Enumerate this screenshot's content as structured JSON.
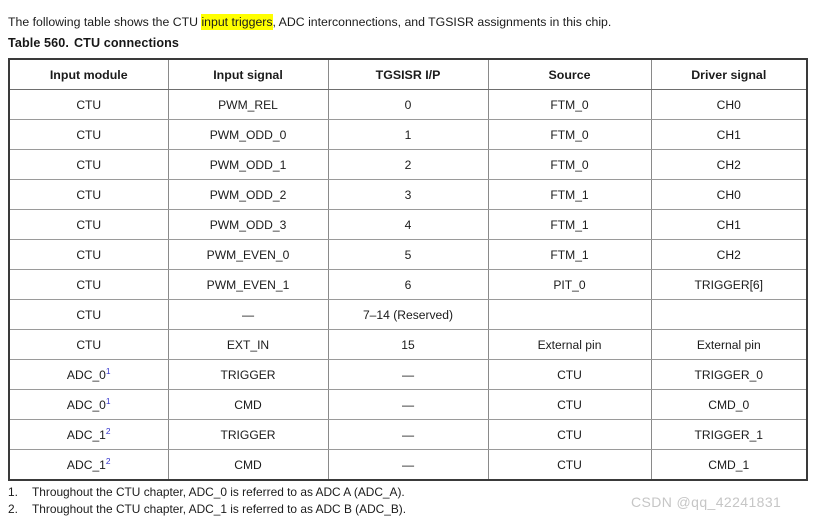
{
  "intro": {
    "before": "The following table shows the CTU ",
    "highlight": "input triggers",
    "after": ", ADC interconnections, and TGSISR assignments in this chip."
  },
  "caption": {
    "number": "Table 560.",
    "title": "CTU connections"
  },
  "table": {
    "headers": [
      "Input module",
      "Input signal",
      "TGSISR I/P",
      "Source",
      "Driver signal"
    ],
    "rows": [
      {
        "module": "CTU",
        "module_sup": "",
        "signal": "PWM_REL",
        "tgsisr": "0",
        "source": "FTM_0",
        "driver": "CH0"
      },
      {
        "module": "CTU",
        "module_sup": "",
        "signal": "PWM_ODD_0",
        "tgsisr": "1",
        "source": "FTM_0",
        "driver": "CH1"
      },
      {
        "module": "CTU",
        "module_sup": "",
        "signal": "PWM_ODD_1",
        "tgsisr": "2",
        "source": "FTM_0",
        "driver": "CH2"
      },
      {
        "module": "CTU",
        "module_sup": "",
        "signal": "PWM_ODD_2",
        "tgsisr": "3",
        "source": "FTM_1",
        "driver": "CH0"
      },
      {
        "module": "CTU",
        "module_sup": "",
        "signal": "PWM_ODD_3",
        "tgsisr": "4",
        "source": "FTM_1",
        "driver": "CH1"
      },
      {
        "module": "CTU",
        "module_sup": "",
        "signal": "PWM_EVEN_0",
        "tgsisr": "5",
        "source": "FTM_1",
        "driver": "CH2"
      },
      {
        "module": "CTU",
        "module_sup": "",
        "signal": "PWM_EVEN_1",
        "tgsisr": "6",
        "source": "PIT_0",
        "driver": "TRIGGER[6]"
      },
      {
        "module": "CTU",
        "module_sup": "",
        "signal": "—",
        "tgsisr": "7–14 (Reserved)",
        "source": "",
        "driver": ""
      },
      {
        "module": "CTU",
        "module_sup": "",
        "signal": "EXT_IN",
        "tgsisr": "15",
        "source": "External pin",
        "driver": "External pin"
      },
      {
        "module": "ADC_0",
        "module_sup": "1",
        "signal": "TRIGGER",
        "tgsisr": "—",
        "source": "CTU",
        "driver": "TRIGGER_0"
      },
      {
        "module": "ADC_0",
        "module_sup": "1",
        "signal": "CMD",
        "tgsisr": "—",
        "source": "CTU",
        "driver": "CMD_0"
      },
      {
        "module": "ADC_1",
        "module_sup": "2",
        "signal": "TRIGGER",
        "tgsisr": "—",
        "source": "CTU",
        "driver": "TRIGGER_1"
      },
      {
        "module": "ADC_1",
        "module_sup": "2",
        "signal": "CMD",
        "tgsisr": "—",
        "source": "CTU",
        "driver": "CMD_1"
      }
    ]
  },
  "footnotes": [
    {
      "number": "1.",
      "text": "Throughout the CTU chapter, ADC_0 is referred to as ADC A (ADC_A)."
    },
    {
      "number": "2.",
      "text": "Throughout the CTU chapter, ADC_1 is referred to as ADC B (ADC_B)."
    }
  ],
  "watermark": "CSDN @qq_42241831",
  "colors": {
    "highlight": "#ffff00",
    "footnote_marker": "#3333cc",
    "watermark": "#c6c6c6",
    "table_border": "#3a3a3a",
    "table_grid": "#9a9a9a"
  }
}
